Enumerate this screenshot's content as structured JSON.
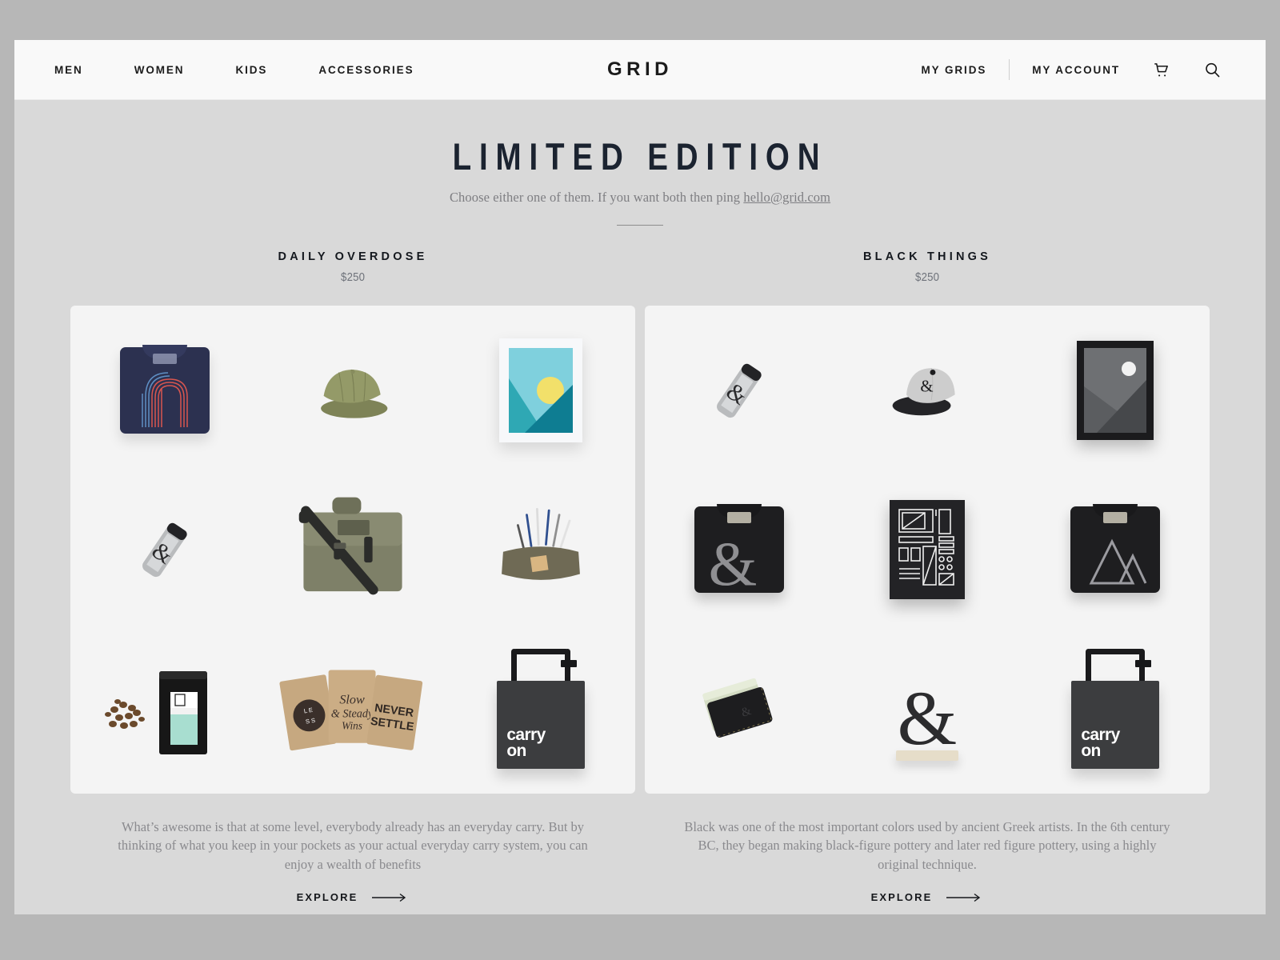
{
  "header": {
    "nav_left": [
      {
        "label": "MEN"
      },
      {
        "label": "WOMEN"
      },
      {
        "label": "KIDS"
      },
      {
        "label": "ACCESSORIES"
      }
    ],
    "brand": "GRID",
    "nav_right": [
      {
        "label": "MY GRIDS"
      },
      {
        "label": "MY ACCOUNT"
      }
    ],
    "cart_icon": "shopping-cart-icon",
    "search_icon": "search-icon"
  },
  "hero": {
    "title": "LIMITED EDITION",
    "subtitle_before": "Choose either one of them. If you want both then ping ",
    "email": "hello@grid.com"
  },
  "columns": [
    {
      "title": "DAILY OVERDOSE",
      "price": "$250",
      "blurb": "What’s awesome is that at some level, everybody already has an everyday carry. But by thinking of what you keep in your pockets as your actual everyday carry system, you can enjoy a wealth of benefits",
      "explore_label": "EXPLORE",
      "products": [
        {
          "name": "navy-graphic-tee"
        },
        {
          "name": "olive-cap"
        },
        {
          "name": "sunset-art-print"
        },
        {
          "name": "steel-water-bottle"
        },
        {
          "name": "canvas-messenger-bag"
        },
        {
          "name": "waxed-pencil-case"
        },
        {
          "name": "coffee-bag"
        },
        {
          "name": "letterpress-notebooks"
        },
        {
          "name": "carry-on-tote"
        }
      ],
      "art": {
        "print_sky": "#7fd0dd",
        "print_sun": "#f2e06a",
        "print_hill_left": "#2fa8b4",
        "print_hill_right": "#0e7d92",
        "tee_body": "#2c3150",
        "tee_arc_red": "#d9564f",
        "tee_arc_blue": "#5e8fc4",
        "cap_color": "#8b8f62",
        "bag_color": "#7e8068",
        "coffee_label": "#a8ded0",
        "notebook_color": "#c6a880",
        "notebook_texts": [
          "LESS",
          "Slow & Steady Wins",
          "NEVER SETTLE"
        ],
        "tote_text_line1": "carry",
        "tote_text_line2": "on"
      }
    },
    {
      "title": "BLACK THINGS",
      "price": "$250",
      "blurb": "Black was one of the most important colors used by ancient Greek artists. In the 6th century BC, they began making black-figure pottery and later red figure pottery, using a highly original technique.",
      "explore_label": "EXPLORE",
      "products": [
        {
          "name": "steel-water-bottle"
        },
        {
          "name": "wool-ampersand-cap"
        },
        {
          "name": "black-framed-print"
        },
        {
          "name": "ampersand-sweatshirt"
        },
        {
          "name": "grid-poster"
        },
        {
          "name": "mountain-tee"
        },
        {
          "name": "leather-card-wallet"
        },
        {
          "name": "ampersand-sculpture"
        },
        {
          "name": "carry-on-tote"
        }
      ],
      "art": {
        "print_bg": "#6e7073",
        "print_hill": "#4a4c4f",
        "print_moon": "#f2f2f2",
        "frame_color": "#1b1b1d",
        "tee_body": "#1e1e20",
        "ampersand_glyph": "&",
        "tote_text_line1": "carry",
        "tote_text_line2": "on"
      }
    }
  ],
  "theme": {
    "page_bg": "#d9d9d9",
    "outer_bg": "#b7b7b7",
    "header_bg": "#f9f9f9",
    "card_bg": "#f4f4f4",
    "text_dark": "#1b2330",
    "text_muted": "#8a8a8e"
  }
}
